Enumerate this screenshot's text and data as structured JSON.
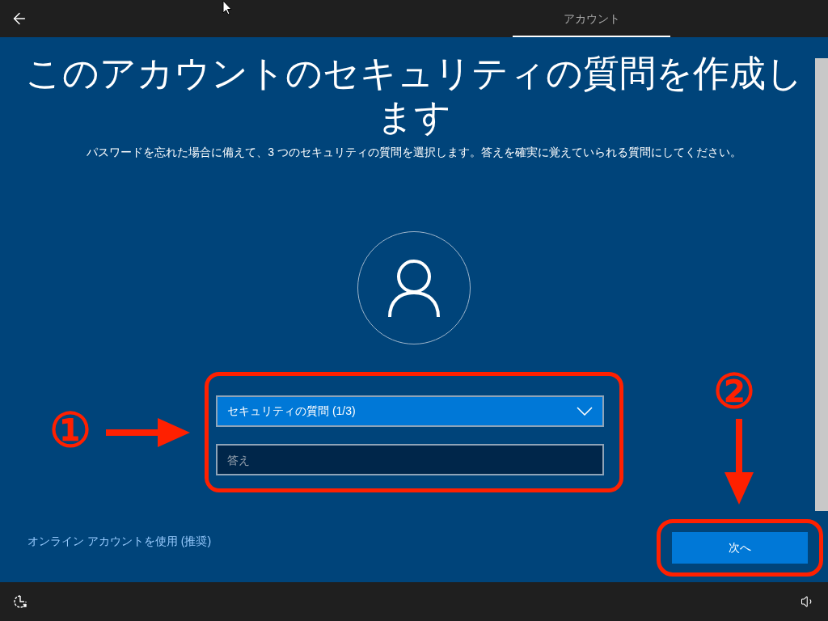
{
  "header": {
    "tabs": [
      {
        "label": "アカウント",
        "selected": true
      }
    ]
  },
  "title": "このアカウントのセキュリティの質問を作成します",
  "subtitle": "パスワードを忘れた場合に備えて、3 つのセキュリティの質問を選択します。答えを確実に覚えていられる質問にしてください。",
  "question_dropdown": {
    "value": "セキュリティの質問 (1/3)"
  },
  "answer_field": {
    "placeholder": "答え"
  },
  "online_account_link": "オンライン アカウントを使用 (推奨)",
  "next_button": "次へ",
  "annotations": [
    {
      "label": "①"
    },
    {
      "label": "②"
    }
  ]
}
